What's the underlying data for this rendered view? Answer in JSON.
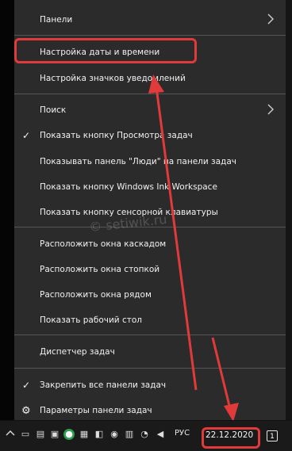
{
  "menu": {
    "items": [
      {
        "label": "Панели",
        "has_submenu": true
      },
      {
        "label": "Настройка даты и времени"
      },
      {
        "label": "Настройка значков уведомлений"
      },
      {
        "label": "Поиск",
        "has_submenu": true
      },
      {
        "label": "Показать кнопку Просмотра задач",
        "checked": true
      },
      {
        "label": "Показывать панель \"Люди\" на панели задач"
      },
      {
        "label": "Показать кнопку Windows Ink Workspace"
      },
      {
        "label": "Показать кнопку сенсорной клавиатуры"
      },
      {
        "label": "Расположить окна каскадом"
      },
      {
        "label": "Расположить окна стопкой"
      },
      {
        "label": "Расположить окна рядом"
      },
      {
        "label": "Показать рабочий стол"
      },
      {
        "label": "Диспетчер задач"
      },
      {
        "label": "Закрепить все панели задач",
        "checked": true
      },
      {
        "label": "Параметры панели задач",
        "icon": "gear-icon"
      }
    ]
  },
  "taskbar": {
    "language": "РУС",
    "date": "22.12.2020",
    "notification_count": "1"
  },
  "watermark": "© setiwik.ru",
  "colors": {
    "menu_bg": "#2b2b2b",
    "text": "#f2f2f2",
    "annotation": "#e03a3a",
    "taskbar_bg": "#1a1a1a"
  }
}
